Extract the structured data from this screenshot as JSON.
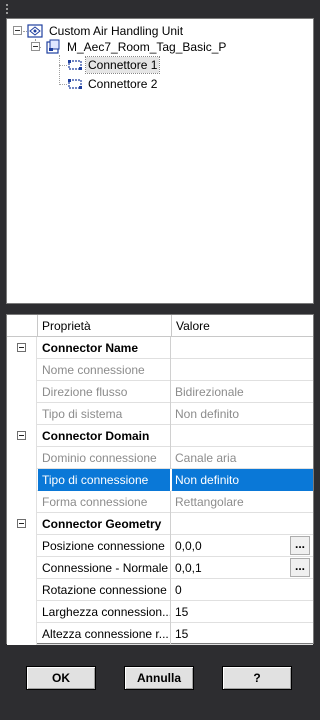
{
  "tree": {
    "root": {
      "label": "Custom Air Handling Unit",
      "icon": "air-handling-unit-icon"
    },
    "family": {
      "label": "M_Aec7_Room_Tag_Basic_P",
      "icon": "family-icon"
    },
    "connectors": [
      {
        "label": "Connettore 1",
        "icon": "connector-icon",
        "selected": true
      },
      {
        "label": "Connettore 2",
        "icon": "connector-icon",
        "selected": false
      }
    ]
  },
  "grid": {
    "header": {
      "property": "Proprietà",
      "value": "Valore"
    },
    "rows": [
      {
        "type": "category",
        "name": "Connector Name",
        "value": ""
      },
      {
        "type": "disabled",
        "name": "Nome connessione",
        "value": ""
      },
      {
        "type": "disabled",
        "name": "Direzione flusso",
        "value": "Bidirezionale"
      },
      {
        "type": "disabled",
        "name": "Tipo di sistema",
        "value": "Non definito"
      },
      {
        "type": "category",
        "name": "Connector Domain",
        "value": ""
      },
      {
        "type": "disabled",
        "name": "Dominio connessione",
        "value": "Canale aria"
      },
      {
        "type": "selected",
        "name": "Tipo di connessione",
        "value": "Non definito"
      },
      {
        "type": "disabled",
        "name": "Forma connessione",
        "value": "Rettangolare"
      },
      {
        "type": "category",
        "name": "Connector Geometry",
        "value": ""
      },
      {
        "type": "editable",
        "name": "Posizione connessione",
        "value": "0,0,0",
        "ellipsis": "..."
      },
      {
        "type": "editable",
        "name": "Connessione - Normale",
        "value": "0,0,1",
        "ellipsis": "..."
      },
      {
        "type": "editable",
        "name": "Rotazione connessione",
        "value": "0"
      },
      {
        "type": "editable",
        "name": "Larghezza connession...",
        "value": "15"
      },
      {
        "type": "editable",
        "name": "Altezza connessione r...",
        "value": "15"
      }
    ]
  },
  "buttons": {
    "ok": "OK",
    "cancel": "Annulla",
    "help": "?"
  },
  "colors": {
    "background": "#2d2d30",
    "selection": "#0a78d7",
    "disabled_text": "#8c8c8c"
  }
}
